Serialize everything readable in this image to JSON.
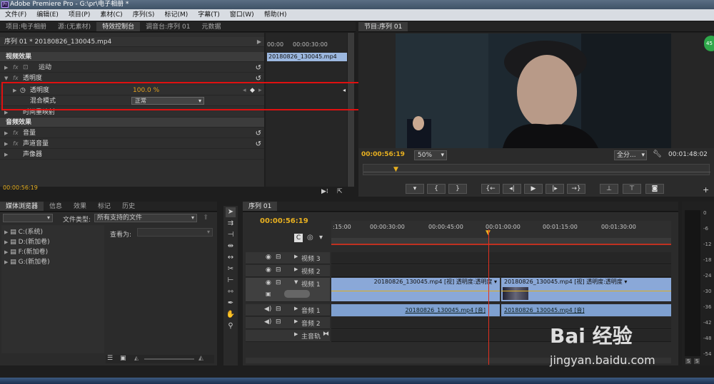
{
  "window": {
    "title": "Adobe Premiere Pro - G:\\pr\\电子相册 *"
  },
  "menu": [
    "文件(F)",
    "编辑(E)",
    "项目(P)",
    "素材(C)",
    "序列(S)",
    "标记(M)",
    "字幕(T)",
    "窗口(W)",
    "帮助(H)"
  ],
  "upper_left_tabs": [
    "项目:电子相册",
    "源:(无素材)",
    "特效控制台",
    "调音台:序列 01",
    "元数据"
  ],
  "effect_controls": {
    "sequence_label": "序列 01 * 20180826_130045.mp4",
    "timeline_times": [
      "00:00",
      "00:00:30:00",
      "00:"
    ],
    "clip_name": "20180826_130045.mp4",
    "video_effects_header": "视频效果",
    "motion": "运动",
    "opacity_group": "透明度",
    "opacity_prop": "透明度",
    "opacity_value": "100.0 %",
    "blend_mode_label": "混合模式",
    "blend_mode_value": "正常",
    "time_remap": "时间重映射",
    "audio_effects_header": "音频效果",
    "volume": "音量",
    "channel_volume": "声道音量",
    "panner": "声像器",
    "current_time": "00:00:56:19"
  },
  "program_monitor": {
    "tab": "节目:序列 01",
    "timecode": "00:00:56:19",
    "zoom": "50%",
    "quality": "全分...",
    "duration": "00:01:48:02",
    "badge": "45"
  },
  "media_browser": {
    "tabs": [
      "媒体浏览器",
      "信息",
      "效果",
      "标记",
      "历史"
    ],
    "file_type_label": "文件类型:",
    "file_type_value": "所有支持的文件",
    "view_as_label": "查看为:",
    "drives": [
      "C:(系统)",
      "D:(新加卷)",
      "F:(新加卷)",
      "G:(新加卷)"
    ]
  },
  "timeline": {
    "tab": "序列 01",
    "timecode": "00:00:56:19",
    "ruler": [
      ":15:00",
      "00:00:30:00",
      "00:00:45:00",
      "00:01:00:00",
      "00:01:15:00",
      "00:01:30:00"
    ],
    "tracks": {
      "v3": "视频 3",
      "v2": "视频 2",
      "v1": "视频 1",
      "a1": "音频 1",
      "a2": "音频 2",
      "master": "主音轨"
    },
    "clip_v1_a": "20180826_130045.mp4  [视] 透明度:透明度 ▾",
    "clip_v1_b": "20180826_130045.mp4  [视] 透明度:透明度 ▾",
    "clip_a1_a": "20180826_130045.mp4  [音]",
    "clip_a1_b": "20180826_130045.mp4  [音]"
  },
  "meter": {
    "db": [
      "0",
      "-6",
      "-12",
      "-18",
      "-24",
      "-30",
      "-36",
      "-42",
      "-48",
      "-54"
    ],
    "solo": [
      "S",
      "S"
    ]
  },
  "watermark": {
    "logo": "Bai 经验",
    "url": "jingyan.baidu.com"
  }
}
